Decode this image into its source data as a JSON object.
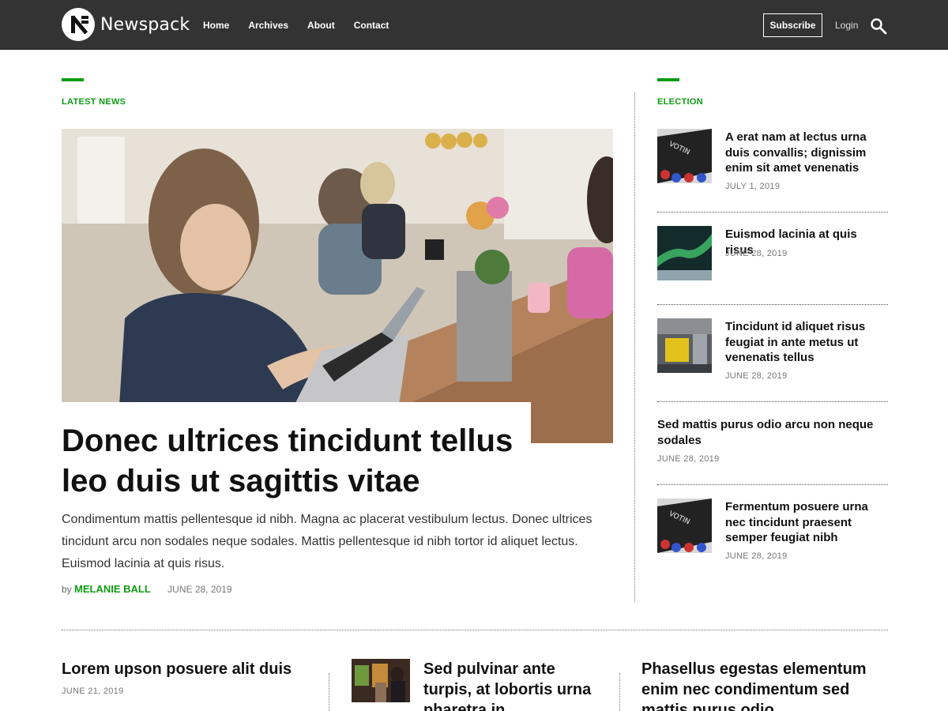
{
  "header": {
    "site_name": "Newspack",
    "nav": [
      "Home",
      "Archives",
      "About",
      "Contact"
    ],
    "subscribe_label": "Subscribe",
    "login_label": "Login"
  },
  "latest": {
    "section_label": "LATEST NEWS",
    "title": "Donec ultrices tincidunt tellus leo duis ut sagittis vitae",
    "excerpt": "Condimentum mattis pellentesque id nibh. Magna ac placerat vestibulum lectus. Donec ultrices tincidunt arcu non sodales neque sodales. Mattis pellentesque id nibh tortor id aliquet lectus. Euismod lacinia at quis risus.",
    "by": "by",
    "author": "MELANIE BALL",
    "date": "JUNE 28, 2019"
  },
  "sidebar": {
    "section_label": "ELECTION",
    "items": [
      {
        "title": "A erat nam at lectus urna duis convallis; dignissim enim sit amet venenatis",
        "date": "JULY 1, 2019"
      },
      {
        "title": "Euismod lacinia at quis risus",
        "date": "JUNE 28, 2019"
      },
      {
        "title": "Tincidunt id aliquet risus feugiat in ante metus ut venenatis tellus",
        "date": "JUNE 28, 2019"
      },
      {
        "title": "Sed mattis purus odio arcu non neque sodales",
        "date": "JUNE 28, 2019"
      },
      {
        "title": "Fermentum posuere urna nec tincidunt praesent semper feugiat nibh",
        "date": "JUNE 28, 2019"
      }
    ]
  },
  "bottom": [
    {
      "title": "Lorem upson posuere alit duis",
      "date": "JUNE 21, 2019"
    },
    {
      "title": "Sed pulvinar ante turpis, at lobortis urna pharetra in",
      "date": ""
    },
    {
      "title": "Phasellus egestas elementum enim nec condimentum sed mattis purus odio",
      "date": ""
    }
  ],
  "colors": {
    "accent": "#0e9c13",
    "header_bg": "#333333"
  }
}
